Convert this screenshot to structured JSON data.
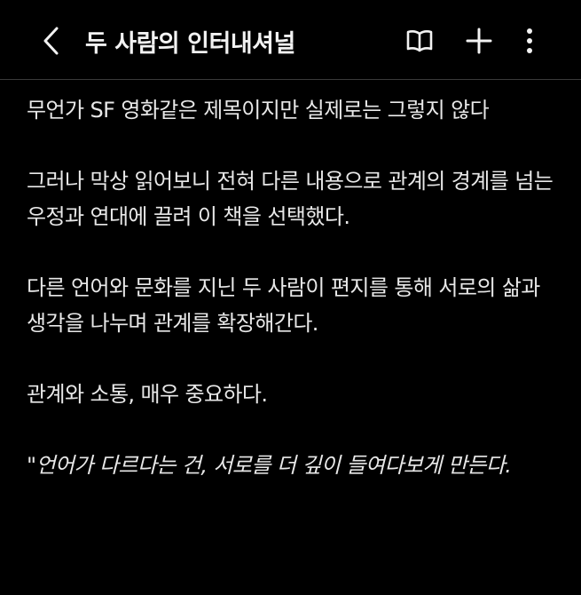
{
  "header": {
    "title": "두 사람의 인터내셔널",
    "back_icon": "chevron-left-icon",
    "book_icon": "open-book-icon",
    "plus_icon": "plus-icon",
    "more_icon": "more-vertical-icon"
  },
  "content": {
    "paragraphs": [
      "무언가 SF 영화같은 제목이지만 실제로는 그렇지 않다",
      "그러나 막상 읽어보니 전혀 다른 내용으로 관계의 경계를 넘는 우정과 연대에 끌려 이 책을 선택했다.",
      "다른 언어와 문화를 지닌 두 사람이 편지를 통해 서로의 삶과 생각을 나누며 관계를 확장해간다.",
      "관계와 소통, 매우 중요하다.",
      "\"언어가 다르다는 건, 서로를 더 깊이 들여다보게 만든다."
    ]
  },
  "colors": {
    "background": "#000000",
    "text": "#e8e8e8",
    "divider": "#3a3a3a"
  }
}
